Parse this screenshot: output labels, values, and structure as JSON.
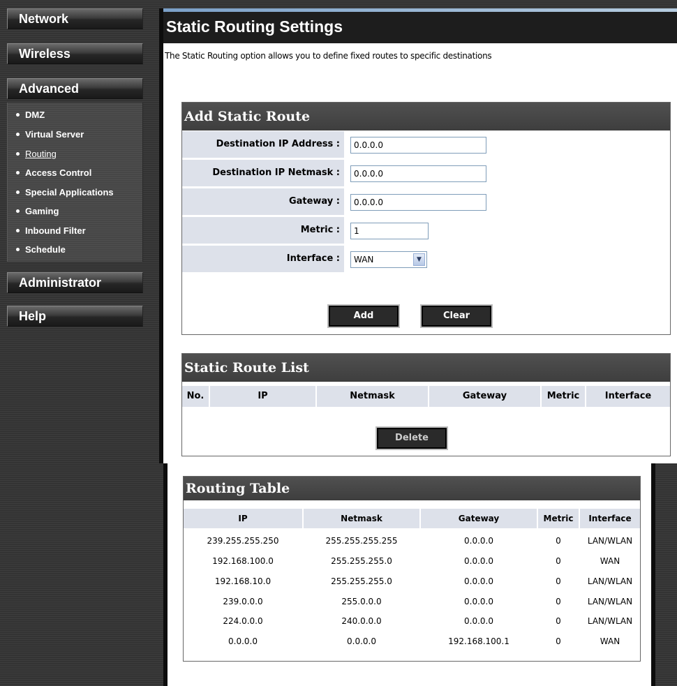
{
  "sidebar": {
    "network": "Network",
    "wireless": "Wireless",
    "advanced": "Advanced",
    "advanced_items": [
      "DMZ",
      "Virtual Server",
      "Routing",
      "Access Control",
      "Special Applications",
      "Gaming",
      "Inbound Filter",
      "Schedule"
    ],
    "administrator": "Administrator",
    "help": "Help"
  },
  "page": {
    "title": "Static Routing Settings",
    "description": "The Static Routing option allows you to define fixed routes to specific destinations"
  },
  "add_route": {
    "heading": "Add Static Route",
    "dest_ip_label": "Destination IP Address :",
    "dest_ip_value": "0.0.0.0",
    "netmask_label": "Destination IP Netmask :",
    "netmask_value": "0.0.0.0",
    "gateway_label": "Gateway :",
    "gateway_value": "0.0.0.0",
    "metric_label": "Metric :",
    "metric_value": "1",
    "interface_label": "Interface :",
    "interface_value": "WAN",
    "add_button": "Add",
    "clear_button": "Clear"
  },
  "route_list": {
    "heading": "Static Route List",
    "columns": [
      "No.",
      "IP",
      "Netmask",
      "Gateway",
      "Metric",
      "Interface"
    ],
    "delete_button": "Delete"
  },
  "routing_table": {
    "heading": "Routing Table",
    "columns": [
      "IP",
      "Netmask",
      "Gateway",
      "Metric",
      "Interface"
    ],
    "rows": [
      [
        "239.255.255.250",
        "255.255.255.255",
        "0.0.0.0",
        "0",
        "LAN/WLAN"
      ],
      [
        "192.168.100.0",
        "255.255.255.0",
        "0.0.0.0",
        "0",
        "WAN"
      ],
      [
        "192.168.10.0",
        "255.255.255.0",
        "0.0.0.0",
        "0",
        "LAN/WLAN"
      ],
      [
        "239.0.0.0",
        "255.0.0.0",
        "0.0.0.0",
        "0",
        "LAN/WLAN"
      ],
      [
        "224.0.0.0",
        "240.0.0.0",
        "0.0.0.0",
        "0",
        "LAN/WLAN"
      ],
      [
        "0.0.0.0",
        "0.0.0.0",
        "192.168.100.1",
        "0",
        "WAN"
      ]
    ]
  }
}
